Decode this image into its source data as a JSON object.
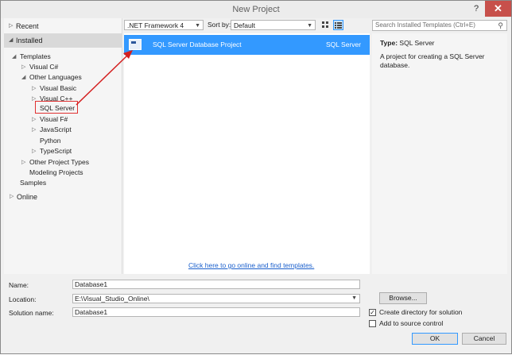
{
  "window": {
    "title": "New Project",
    "help": "?",
    "close": "✕"
  },
  "left_nav": {
    "recent": "Recent",
    "installed": "Installed",
    "tree": [
      {
        "label": "Templates",
        "arrow": "◢"
      },
      {
        "label": "Visual C#",
        "arrow": "▷"
      },
      {
        "label": "Other Languages",
        "arrow": "◢"
      },
      {
        "label": "Visual Basic",
        "arrow": "▷"
      },
      {
        "label": "Visual C++",
        "arrow": "▷"
      },
      {
        "label": "SQL Server",
        "arrow": ""
      },
      {
        "label": "Visual F#",
        "arrow": "▷"
      },
      {
        "label": "JavaScript",
        "arrow": "▷"
      },
      {
        "label": "Python",
        "arrow": ""
      },
      {
        "label": "TypeScript",
        "arrow": "▷"
      },
      {
        "label": "Other Project Types",
        "arrow": "▷"
      },
      {
        "label": "Modeling Projects",
        "arrow": ""
      },
      {
        "label": "Samples",
        "arrow": ""
      }
    ],
    "online": "Online"
  },
  "toolbar": {
    "framework": ".NET Framework 4",
    "sort_label": "Sort by:",
    "sort_value": "Default",
    "search_placeholder": "Search Installed Templates (Ctrl+E)"
  },
  "templates": [
    {
      "name": "SQL Server Database Project",
      "language": "SQL Server"
    }
  ],
  "online_link": "Click here to go online and find templates.",
  "details": {
    "type_label": "Type:",
    "type_value": "SQL Server",
    "description": "A project for creating a SQL Server database."
  },
  "form": {
    "name_label": "Name:",
    "name_value": "Database1",
    "location_label": "Location:",
    "location_value": "E:\\Visual_Studio_Online\\",
    "solution_label": "Solution name:",
    "solution_value": "Database1",
    "browse": "Browse...",
    "create_dir": "Create directory for solution",
    "create_dir_checked": true,
    "add_source": "Add to source control",
    "add_source_checked": false,
    "ok": "OK",
    "cancel": "Cancel"
  },
  "colors": {
    "selection": "#3399ff",
    "highlight_box": "#e03030",
    "close_button": "#c7504b",
    "link": "#1a5fcc"
  }
}
